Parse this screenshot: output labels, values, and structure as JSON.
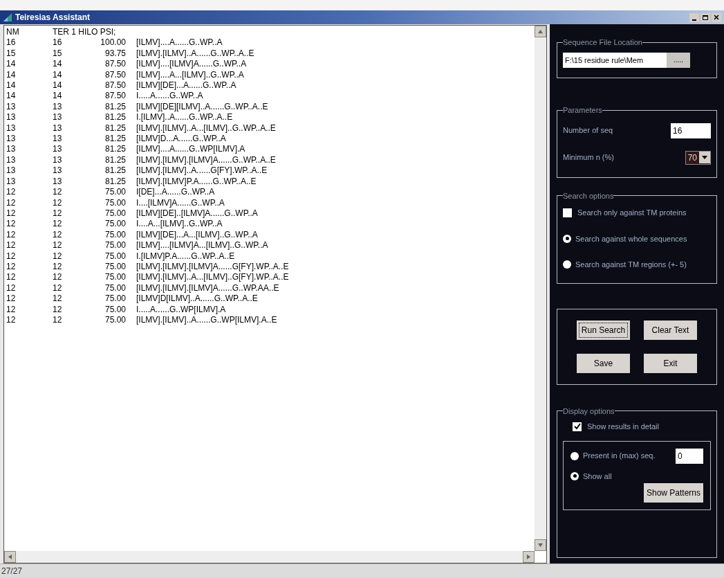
{
  "window": {
    "title": "Teiresias Assistant"
  },
  "results": {
    "header": [
      "NM",
      "TER 1 HILO PSI;"
    ],
    "rows": [
      [
        "16",
        "16",
        "100.00",
        "[ILMV]....A......G..WP..A"
      ],
      [
        "15",
        "15",
        "93.75",
        "[ILMV].[ILMV]..A......G..WP..A..E"
      ],
      [
        "14",
        "14",
        "87.50",
        "[ILMV]....[ILMV]A......G..WP..A"
      ],
      [
        "14",
        "14",
        "87.50",
        "[ILMV]....A...[ILMV]..G..WP..A"
      ],
      [
        "14",
        "14",
        "87.50",
        "[ILMV][DE]...A......G..WP..A"
      ],
      [
        "14",
        "14",
        "87.50",
        "I.....A......G..WP..A"
      ],
      [
        "13",
        "13",
        "81.25",
        "[ILMV][DE][ILMV]..A......G..WP..A..E"
      ],
      [
        "13",
        "13",
        "81.25",
        "I.[ILMV]..A......G..WP..A..E"
      ],
      [
        "13",
        "13",
        "81.25",
        "[ILMV].[ILMV]..A...[ILMV]..G..WP..A..E"
      ],
      [
        "13",
        "13",
        "81.25",
        "[ILMV]D...A......G..WP..A"
      ],
      [
        "13",
        "13",
        "81.25",
        "[ILMV]....A......G..WP[ILMV].A"
      ],
      [
        "13",
        "13",
        "81.25",
        "[ILMV].[ILMV].[ILMV]A......G..WP..A..E"
      ],
      [
        "13",
        "13",
        "81.25",
        "[ILMV].[ILMV]..A......G[FY].WP..A..E"
      ],
      [
        "13",
        "13",
        "81.25",
        "[ILMV].[ILMV]P.A......G..WP..A..E"
      ],
      [
        "12",
        "12",
        "75.00",
        "I[DE]...A......G..WP..A"
      ],
      [
        "12",
        "12",
        "75.00",
        "I....[ILMV]A......G..WP..A"
      ],
      [
        "12",
        "12",
        "75.00",
        "[ILMV][DE]..[ILMV]A......G..WP..A"
      ],
      [
        "12",
        "12",
        "75.00",
        "I....A...[ILMV]..G..WP..A"
      ],
      [
        "12",
        "12",
        "75.00",
        "[ILMV][DE]...A...[ILMV]..G..WP..A"
      ],
      [
        "12",
        "12",
        "75.00",
        "[ILMV]....[ILMV]A...[ILMV]..G..WP..A"
      ],
      [
        "12",
        "12",
        "75.00",
        "I.[ILMV]P.A......G..WP..A..E"
      ],
      [
        "12",
        "12",
        "75.00",
        "[ILMV].[ILMV].[ILMV]A......G[FY].WP..A..E"
      ],
      [
        "12",
        "12",
        "75.00",
        "[ILMV].[ILMV]..A...[ILMV]..G[FY].WP..A..E"
      ],
      [
        "12",
        "12",
        "75.00",
        "[ILMV].[ILMV].[ILMV]A......G..WP.AA..E"
      ],
      [
        "12",
        "12",
        "75.00",
        "[ILMV]D[ILMV]..A......G..WP..A..E"
      ],
      [
        "12",
        "12",
        "75.00",
        "I.....A......G..WP[ILMV].A"
      ],
      [
        "12",
        "12",
        "75.00",
        "[ILMV].[ILMV]..A......G..WP[ILMV].A..E"
      ]
    ]
  },
  "sequence_file": {
    "legend": "Sequence File Location",
    "path": "F:\\15 residue rule\\Mem",
    "browse": "....."
  },
  "parameters": {
    "legend": "Parameters",
    "number_of_seq": {
      "label": "Number of seq",
      "value": "16"
    },
    "minimum": {
      "label": "Minimum n (%)",
      "value": "70"
    }
  },
  "search_options": {
    "legend": "Search options",
    "only_tm": {
      "label": "Search only against TM proteins",
      "checked": false
    },
    "scope": [
      {
        "label": "Search against whole sequences",
        "selected": true
      },
      {
        "label": "Search against TM regions (+- 5)",
        "selected": false
      }
    ]
  },
  "actions": [
    {
      "label": "Run Search",
      "focused": true
    },
    {
      "label": "Clear Text",
      "focused": false
    },
    {
      "label": "Save",
      "focused": false
    },
    {
      "label": "Exit",
      "focused": false
    }
  ],
  "display_options": {
    "legend": "Display options",
    "show_detail": {
      "label": "Show results in detail",
      "checked": true
    },
    "modes": [
      {
        "label": "Present in (max) seq.",
        "selected": false,
        "value": "0"
      },
      {
        "label": "Show all",
        "selected": true
      }
    ],
    "show_patterns": "Show Patterns"
  },
  "status_bar": {
    "count": "27/27"
  }
}
